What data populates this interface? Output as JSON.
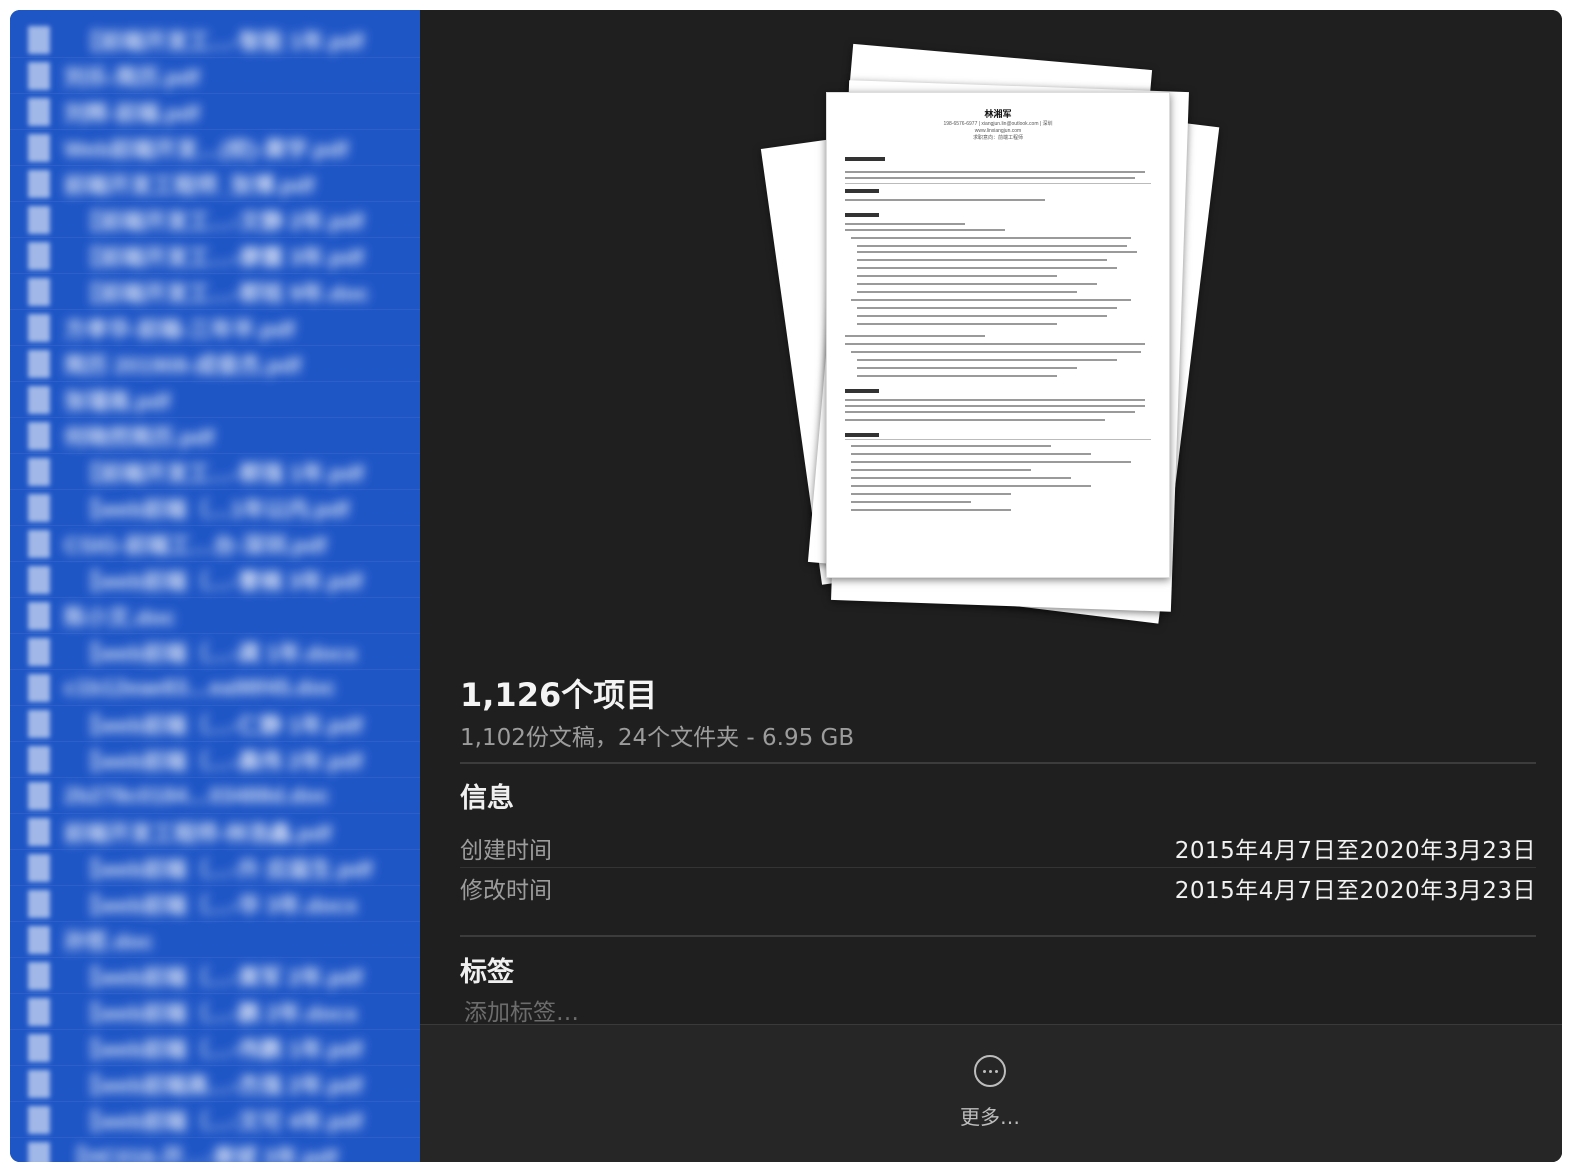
{
  "sidebar": {
    "files": [
      {
        "name": "【前端开发工…-智能 1年.pdf",
        "indent": true
      },
      {
        "name": "刘乐-简历.pdf",
        "indent": false
      },
      {
        "name": "刘辉-前端.pdf",
        "indent": false
      },
      {
        "name": "Web前端开发…(校)-黄宇.pdf",
        "indent": false
      },
      {
        "name": "前端开发工程师_张博.pdf",
        "indent": false
      },
      {
        "name": "【前端开发工…-文静 2年.pdf",
        "indent": true
      },
      {
        "name": "【前端开发工…-廖露 3年.pdf",
        "indent": true
      },
      {
        "name": "【前端开发工…-郭铭 9年.doc",
        "indent": true
      },
      {
        "name": "方孝华-前端-三年半.pdf",
        "indent": false
      },
      {
        "name": "简历 201908-成俊杰.pdf",
        "indent": false
      },
      {
        "name": "张瑾南.pdf",
        "indent": false
      },
      {
        "name": "何晓然简历.pdf",
        "indent": false
      },
      {
        "name": "【前端开发工…-郭强 1年.pdf",
        "indent": true
      },
      {
        "name": "【web前端（…1年以内.pdf",
        "indent": true
      },
      {
        "name": "CSIG-前端工…台-深圳.pdf",
        "indent": false
      },
      {
        "name": "【web前端（…-曹楠 3年.pdf",
        "indent": true
      },
      {
        "name": "陈小文.doc",
        "indent": false
      },
      {
        "name": "【web前端（…-龚 1年.docx",
        "indent": true
      },
      {
        "name": "c1b12eae83…ea98f45.doc",
        "indent": false
      },
      {
        "name": "【web前端（…-仁静 1年.pdf",
        "indent": true
      },
      {
        "name": "【web前端（…-晨伟 2年.pdf",
        "indent": true
      },
      {
        "name": "2b278c0184…03488d.doc",
        "indent": false
      },
      {
        "name": "前端开发工程师-林浩鑫.pdf",
        "indent": false
      },
      {
        "name": "【web前端（…-升 应届生.pdf",
        "indent": true
      },
      {
        "name": "【web前端（…-华 3年.docx",
        "indent": true
      },
      {
        "name": "孙哲.doc",
        "indent": false
      },
      {
        "name": "【web前端（…-黄军 2年.pdf",
        "indent": true
      },
      {
        "name": "【web前端（…-鹏 2年.docx",
        "indent": true
      },
      {
        "name": "【web前端（…-伟鹏 1年.pdf",
        "indent": true
      },
      {
        "name": "【web前端高…-杰强 2年.pdf",
        "indent": true
      },
      {
        "name": "【web前端（…-文可 4年.pdf",
        "indent": true
      },
      {
        "name": "【HC016-开…-黄斌 3年.pdf",
        "indent": false
      }
    ]
  },
  "preview": {
    "doc_name": "林湘军",
    "doc_contact_1": "198-6576-6977 | xiangjun.lin@outlook.com | 深圳",
    "doc_contact_2": "www.linxiangjun.com",
    "doc_contact_3": "求职意向：前端工程师"
  },
  "summary": {
    "count_title": "1,126个项目",
    "count_sub": "1,102份文稿，24个文件夹 - 6.95 GB"
  },
  "info": {
    "title": "信息",
    "rows": [
      {
        "label": "创建时间",
        "value": "2015年4月7日至2020年3月23日"
      },
      {
        "label": "修改时间",
        "value": "2015年4月7日至2020年3月23日"
      }
    ]
  },
  "tags": {
    "title": "标签",
    "placeholder": "添加标签…"
  },
  "footer": {
    "more_label": "更多…",
    "more_icon": "ellipsis-circle-icon"
  },
  "colors": {
    "sidebar_selection": "#1f56c6",
    "panel_bg": "#1f1f1f"
  }
}
